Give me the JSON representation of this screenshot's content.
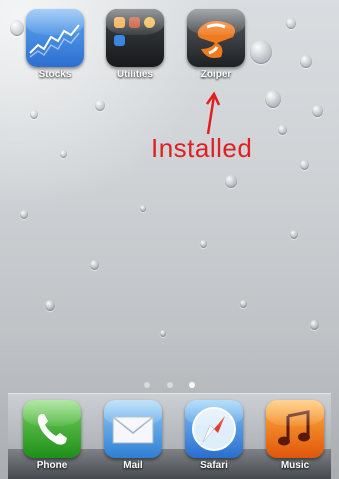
{
  "home": {
    "apps": [
      {
        "label": "Stocks",
        "icon": "stocks-icon"
      },
      {
        "label": "Utilities",
        "icon": "utilities-folder-icon"
      },
      {
        "label": "Zoiper",
        "icon": "zoiper-icon"
      }
    ],
    "annotation": "Installed",
    "annotation_color": "#e02020",
    "pages": 3,
    "current_page": 3
  },
  "dock": {
    "apps": [
      {
        "label": "Phone",
        "icon": "phone-icon"
      },
      {
        "label": "Mail",
        "icon": "mail-icon"
      },
      {
        "label": "Safari",
        "icon": "safari-icon"
      },
      {
        "label": "Music",
        "icon": "music-icon"
      }
    ]
  }
}
